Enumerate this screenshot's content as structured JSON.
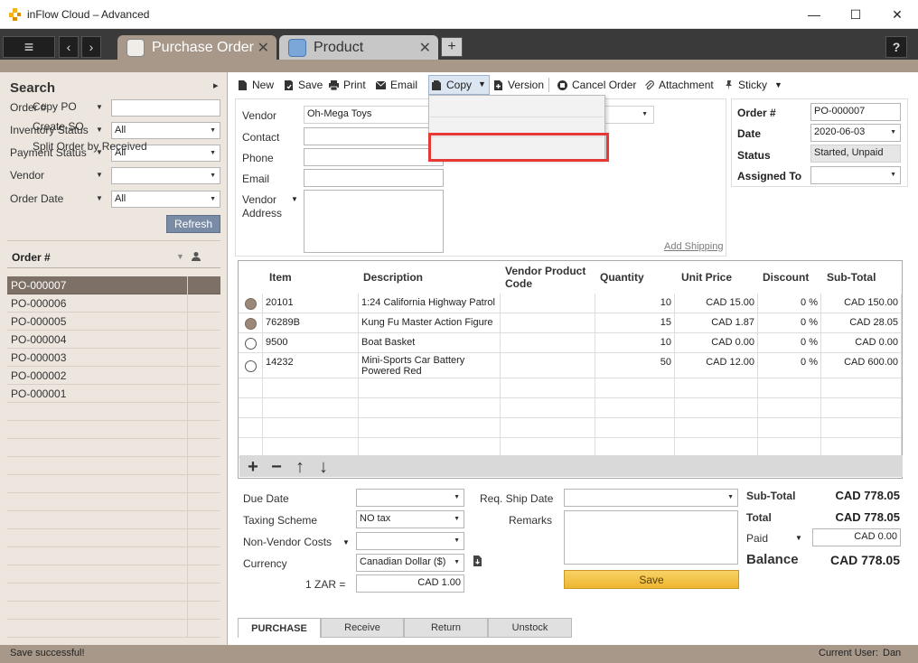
{
  "window": {
    "title": "inFlow Cloud – Advanced",
    "controls": {
      "minimize": "—",
      "maximize": "☐",
      "close": "✕"
    }
  },
  "tabs": [
    {
      "label": "Purchase Order",
      "close": "✕"
    },
    {
      "label": "Product",
      "close": "✕"
    }
  ],
  "tabbar": {
    "menu": "≡",
    "back": "‹",
    "forward": "›",
    "add": "+",
    "help": "?"
  },
  "sidebar": {
    "title": "Search",
    "collapse": "▸",
    "filters": [
      {
        "label": "Order #",
        "value": ""
      },
      {
        "label": "Inventory Status",
        "value": "All"
      },
      {
        "label": "Payment Status",
        "value": "All"
      },
      {
        "label": "Vendor",
        "value": ""
      },
      {
        "label": "Order Date",
        "value": "All"
      }
    ],
    "refresh": "Refresh",
    "list_header": "Order #",
    "orders": [
      "PO-000007",
      "PO-000006",
      "PO-000005",
      "PO-000004",
      "PO-000003",
      "PO-000002",
      "PO-000001"
    ]
  },
  "toolbar": {
    "new": "New",
    "save": "Save",
    "print": "Print",
    "email": "Email",
    "copy": "Copy",
    "version": "Version",
    "cancel": "Cancel Order",
    "attachment": "Attachment",
    "sticky": "Sticky"
  },
  "copy_menu": [
    "Copy PO",
    "Create SO",
    "Split Order by Received"
  ],
  "vendor": {
    "vendor_label": "Vendor",
    "vendor_value": "Oh-Mega Toys",
    "contact_label": "Contact",
    "phone_label": "Phone",
    "email_label": "Email",
    "address_label_1": "Vendor",
    "address_label_2": "Address",
    "add_shipping": "Add Shipping"
  },
  "order": {
    "order_no_label": "Order #",
    "order_no": "PO-000007",
    "date_label": "Date",
    "date": "2020-06-03",
    "status_label": "Status",
    "status": "Started, Unpaid",
    "assigned_label": "Assigned To",
    "assigned": ""
  },
  "grid": {
    "headers": {
      "item": "Item",
      "description": "Description",
      "vpc": "Vendor Product Code",
      "qty": "Quantity",
      "price": "Unit Price",
      "discount": "Discount",
      "subtotal": "Sub-Total"
    },
    "rows": [
      {
        "item": "20101",
        "description": "1:24 California Highway Patrol",
        "vpc": "",
        "qty": "10",
        "price": "CAD 15.00",
        "discount": "0 %",
        "subtotal": "CAD 150.00",
        "received": true
      },
      {
        "item": "76289B",
        "description": "Kung Fu Master Action Figure",
        "vpc": "",
        "qty": "15",
        "price": "CAD 1.87",
        "discount": "0 %",
        "subtotal": "CAD 28.05",
        "received": true
      },
      {
        "item": "9500",
        "description": "Boat Basket",
        "vpc": "",
        "qty": "10",
        "price": "CAD 0.00",
        "discount": "0 %",
        "subtotal": "CAD 0.00",
        "received": false
      },
      {
        "item": "14232",
        "description": "Mini-Sports Car Battery Powered Red",
        "vpc": "",
        "qty": "50",
        "price": "CAD 12.00",
        "discount": "0 %",
        "subtotal": "CAD 600.00",
        "received": false
      }
    ],
    "buttons": {
      "add": "+",
      "remove": "−",
      "up": "↑",
      "down": "↓"
    }
  },
  "bottom": {
    "due_date_label": "Due Date",
    "due_date": "",
    "taxing_label": "Taxing Scheme",
    "taxing": "NO tax",
    "nonvendor_label": "Non-Vendor Costs",
    "nonvendor": "",
    "currency_label": "Currency",
    "currency": "Canadian Dollar ($)",
    "rate_label": "1 ZAR =",
    "rate": "CAD 1.00",
    "ship_label": "Req. Ship Date",
    "ship": "",
    "remarks_label": "Remarks",
    "save": "Save"
  },
  "totals": {
    "subtotal_label": "Sub-Total",
    "subtotal": "CAD 778.05",
    "total_label": "Total",
    "total": "CAD 778.05",
    "paid_label": "Paid",
    "paid": "CAD 0.00",
    "balance_label": "Balance",
    "balance": "CAD 778.05"
  },
  "bottom_tabs": [
    "PURCHASE",
    "Receive",
    "Return",
    "Unstock"
  ],
  "status": {
    "message": "Save successful!",
    "user_label": "Current User:",
    "user": "Dan"
  }
}
